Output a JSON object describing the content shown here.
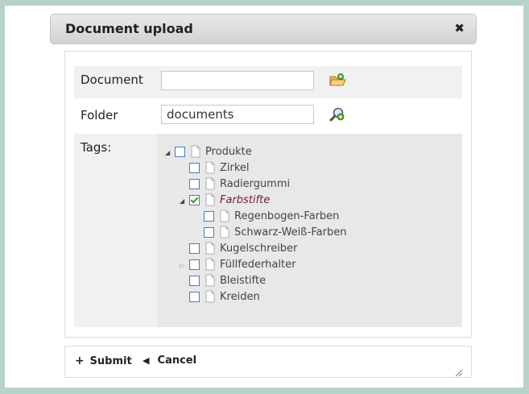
{
  "dialog": {
    "title": "Document upload",
    "close_glyph": "✖"
  },
  "form": {
    "document": {
      "label": "Document",
      "value": "",
      "icon": "folder-open-icon"
    },
    "folder": {
      "label": "Folder",
      "value": "documents",
      "icon": "search-add-icon"
    },
    "tags": {
      "label": "Tags:"
    }
  },
  "tree": {
    "nodes": [
      {
        "label": "Produkte",
        "level": 0,
        "toggle": "expanded",
        "checked": false
      },
      {
        "label": "Zirkel",
        "level": 1,
        "toggle": "none",
        "checked": false
      },
      {
        "label": "Radiergummi",
        "level": 1,
        "toggle": "none",
        "checked": false
      },
      {
        "label": "Farbstifte",
        "level": 1,
        "toggle": "expanded",
        "checked": true,
        "selected": true
      },
      {
        "label": "Regenbogen-Farben",
        "level": 2,
        "toggle": "none",
        "checked": false
      },
      {
        "label": "Schwarz-Weiß-Farben",
        "level": 2,
        "toggle": "none",
        "checked": false
      },
      {
        "label": "Kugelschreiber",
        "level": 1,
        "toggle": "none",
        "checked": false
      },
      {
        "label": "Füllfederhalter",
        "level": 1,
        "toggle": "collapsed",
        "checked": false
      },
      {
        "label": "Bleistifte",
        "level": 1,
        "toggle": "none",
        "checked": false
      },
      {
        "label": "Kreiden",
        "level": 1,
        "toggle": "none",
        "checked": false
      }
    ]
  },
  "footer": {
    "submit_label": "Submit",
    "submit_icon": "+",
    "cancel_label": "Cancel",
    "cancel_icon": "◀"
  },
  "colors": {
    "background": "#b7d3c7",
    "checkbox_border": "#4a78c8",
    "check_mark": "#3a9a2a",
    "selected_text": "#7a1e2e"
  }
}
